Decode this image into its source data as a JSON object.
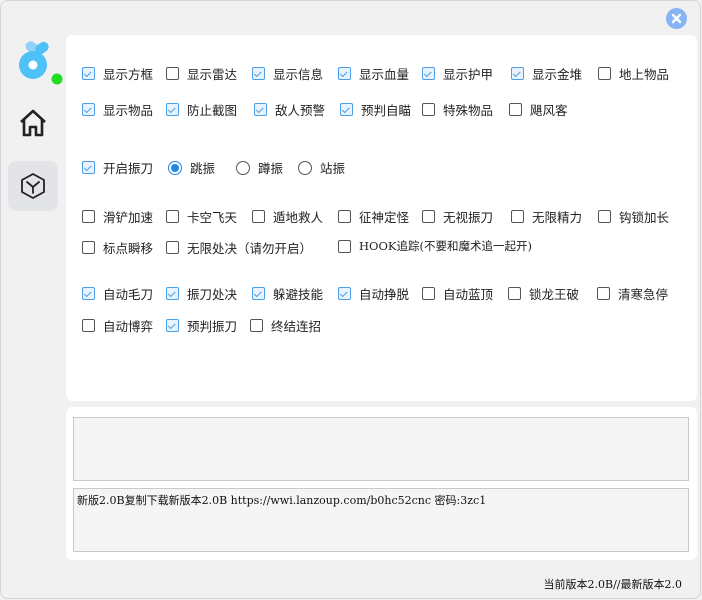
{
  "window": {
    "close_icon": "close-icon",
    "accent_color": "#1e88e5"
  },
  "sidebar": {
    "logo": "app-logo",
    "status_dot_color": "#22dd22",
    "items": [
      {
        "name": "home",
        "icon": "home-icon",
        "active": false
      },
      {
        "name": "game",
        "icon": "cube-icon",
        "active": true
      }
    ]
  },
  "options": {
    "row1": [
      {
        "label": "显示方框",
        "checked": true
      },
      {
        "label": "显示雷达",
        "checked": false
      },
      {
        "label": "显示信息",
        "checked": true
      },
      {
        "label": "显示血量",
        "checked": true
      },
      {
        "label": "显示护甲",
        "checked": true
      },
      {
        "label": "显示金堆",
        "checked": true
      },
      {
        "label": "地上物品",
        "checked": false
      }
    ],
    "row2": [
      {
        "label": "显示物品",
        "checked": true
      },
      {
        "label": "防止截图",
        "checked": true
      },
      {
        "label": "敌人预警",
        "checked": true
      },
      {
        "label": "预判自瞄",
        "checked": true
      },
      {
        "label": "特殊物品",
        "checked": false
      },
      {
        "label": "飓风客",
        "checked": false
      }
    ],
    "vibrate": {
      "toggle": {
        "label": "开启振刀",
        "checked": true
      },
      "modes": [
        {
          "label": "跳振",
          "selected": true
        },
        {
          "label": "蹲振",
          "selected": false
        },
        {
          "label": "站振",
          "selected": false
        }
      ]
    },
    "row3": [
      {
        "label": "滑铲加速",
        "checked": false
      },
      {
        "label": "卡空飞天",
        "checked": false
      },
      {
        "label": "遁地救人",
        "checked": false
      },
      {
        "label": "征神定怪",
        "checked": false
      },
      {
        "label": "无视振刀",
        "checked": false
      },
      {
        "label": "无限精力",
        "checked": false
      },
      {
        "label": "钩锁加长",
        "checked": false
      }
    ],
    "row4": [
      {
        "label": "标点瞬移",
        "checked": false
      },
      {
        "label": "无限处决（请勿开启）",
        "checked": false
      },
      {
        "label": "HOOK追踪(不要和魔术追一起开)",
        "checked": false
      }
    ],
    "row5": [
      {
        "label": "自动毛刀",
        "checked": true
      },
      {
        "label": "振刀处决",
        "checked": true
      },
      {
        "label": "躲避技能",
        "checked": true
      },
      {
        "label": "自动挣脱",
        "checked": true
      },
      {
        "label": "自动蓝顶",
        "checked": false
      },
      {
        "label": "锁龙王破",
        "checked": false
      },
      {
        "label": "清寒急停",
        "checked": false
      }
    ],
    "row6": [
      {
        "label": "自动博弈",
        "checked": false
      },
      {
        "label": "预判振刀",
        "checked": true
      },
      {
        "label": "终结连招",
        "checked": false
      }
    ]
  },
  "log": {
    "text": ""
  },
  "news": {
    "text": "新版2.0B复制下载新版本2.0B https://wwi.lanzoup.com/b0hc52cnc 密码:3zc1"
  },
  "footer": {
    "version_text": "当前版本2.0B//最新版本2.0"
  }
}
